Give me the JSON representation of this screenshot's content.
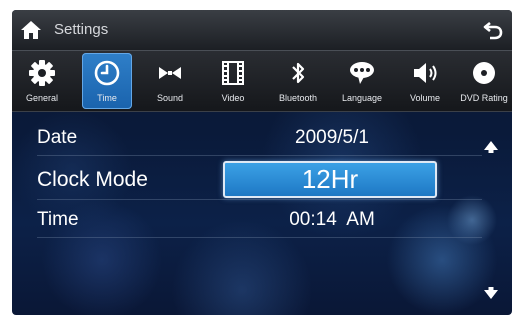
{
  "titlebar": {
    "title": "Settings"
  },
  "tabs": [
    {
      "label": "General",
      "icon": "gear-icon"
    },
    {
      "label": "Time",
      "icon": "clock-icon"
    },
    {
      "label": "Sound",
      "icon": "sound-icon"
    },
    {
      "label": "Video",
      "icon": "film-icon"
    },
    {
      "label": "Bluetooth",
      "icon": "bluetooth-icon"
    },
    {
      "label": "Language",
      "icon": "speech-bubble-icon"
    },
    {
      "label": "Volume",
      "icon": "speaker-icon"
    },
    {
      "label": "DVD Rating",
      "icon": "disc-icon"
    }
  ],
  "active_tab": "Time",
  "settings": {
    "date": {
      "label": "Date",
      "value": "2009/5/1"
    },
    "clock_mode": {
      "label": "Clock Mode",
      "value": "12Hr"
    },
    "time": {
      "label": "Time",
      "value": "00:14  AM"
    }
  },
  "colors": {
    "accent": "#1e78c4",
    "active_tab": "#2f7fc8",
    "background": "#0c2148"
  }
}
